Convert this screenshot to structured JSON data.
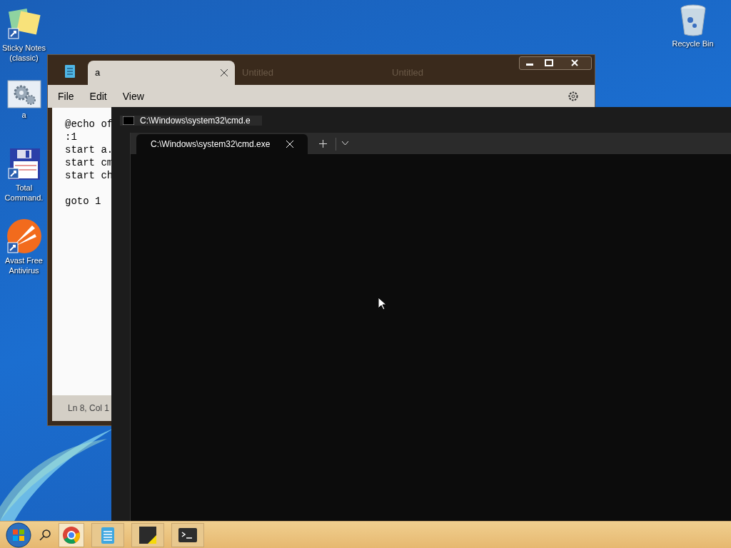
{
  "desktop_icons": [
    {
      "kind": "sticky",
      "label": "Sticky Notes (classic)"
    },
    {
      "kind": "gears",
      "label": "a"
    },
    {
      "kind": "floppy",
      "label": "Total Command."
    },
    {
      "kind": "avast",
      "label": "Avast Free Antivirus"
    },
    {
      "kind": "bin",
      "label": "Recycle Bin"
    }
  ],
  "notepad": {
    "tabs": [
      {
        "label": "a",
        "selected": true
      },
      {
        "label": "Untitled",
        "selected": false
      },
      {
        "label": "Untitled",
        "selected": false
      }
    ],
    "menu": [
      "File",
      "Edit",
      "View"
    ],
    "line_groups": [
      [
        "@echo of",
        ":1",
        "start a.",
        "start cm",
        "start ch"
      ],
      [
        "goto 1"
      ]
    ],
    "status": "Ln 8, Col 1"
  },
  "terminal_back": {
    "tab": "C:\\Windows\\system32\\cmd.e"
  },
  "terminal": {
    "tabs": [
      {
        "label": "C:\\Windows\\system32\\cmd.exe",
        "selected": true
      }
    ]
  },
  "taskbar": [
    {
      "kind": "start"
    },
    {
      "kind": "search"
    },
    {
      "kind": "chrome"
    },
    {
      "kind": "notepad"
    },
    {
      "kind": "sticky"
    },
    {
      "kind": "terminal"
    }
  ]
}
